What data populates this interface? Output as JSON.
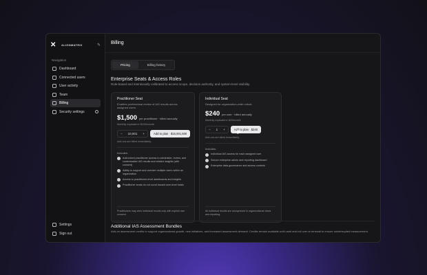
{
  "brand": {
    "name": "ALIGNMATRIX"
  },
  "sidebar": {
    "title": "Navigation",
    "items": [
      {
        "label": "Dashboard"
      },
      {
        "label": "Connected users"
      },
      {
        "label": "User activity"
      },
      {
        "label": "Team"
      },
      {
        "label": "Billing"
      },
      {
        "label": "Security settings"
      }
    ],
    "bottom": [
      {
        "label": "Settings"
      },
      {
        "label": "Sign out"
      }
    ]
  },
  "page": {
    "title": "Billing",
    "tabs": [
      {
        "label": "Pricing"
      },
      {
        "label": "Billing history"
      }
    ],
    "section_title": "Enterprise Seats & Access Roles",
    "section_sub": "Role-based and intentionally calibrated to access scope, decision authority, and system-level visibility."
  },
  "left_card": {
    "title": "Practitioner Seat",
    "desc": "Enables professional review of IAS results across assigned users.",
    "price": "$1,500",
    "price_note": "per practitioner · billed annually",
    "equiv": "Monthly equivalent: $125/month",
    "qty": "10,001",
    "button": "Add to plan · $15,001,500",
    "hint": "Add-ons are billed immediately.",
    "includes": "Includes:",
    "features": [
      "Authorized practitioner access to administer, review, and contextualize IAS results and related insights (with consent)",
      "Ability to support and oversee multiple users within an organization",
      "Access to practitioner-level dashboards and insights",
      "Practitioner seats do not count toward user-level totals"
    ],
    "footer": "Practitioners may view individual results only with explicit user consent."
  },
  "right_card": {
    "title": "Individual Seat",
    "desc": "Designed for organization-wide rollout.",
    "price": "$240",
    "price_note": "per user · billed annually",
    "equiv": "Monthly equivalent: $20/month",
    "qty": "1",
    "button": "Add to plan · $240",
    "hint": "Add-ons are billed immediately.",
    "includes": "Includes:",
    "features": [
      "Individual IAS access for each assigned user",
      "Secure enterprise admin and reporting dashboard",
      "Enterprise data governance and access controls"
    ],
    "footer": "All individual results are anonymized in organizational views and reporting."
  },
  "bundles": {
    "title": "Additional IAS Assessment Bundles",
    "desc": "Add-on assessment credits to support organizational growth, new initiatives, and increased assessment demand. Credits remain available until used and roll over at renewal to ensure uninterrupted measurement."
  }
}
